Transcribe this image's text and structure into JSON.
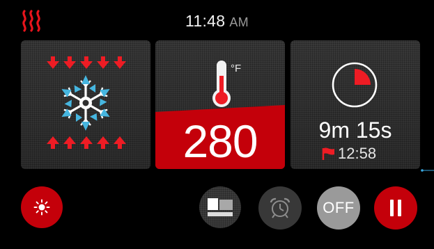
{
  "status_bar": {
    "heat_indicator_icon": "heat-waves-icon",
    "time": "11:48",
    "ampm": "AM"
  },
  "tiles": {
    "convection": {
      "icon": "convection-fan-icon"
    },
    "temperature": {
      "value": "280",
      "unit": "°F",
      "icon": "thermometer-icon"
    },
    "timer": {
      "icon": "timer-dial-icon",
      "remaining": "9m 15s",
      "end_time": "12:58",
      "end_icon": "flag-icon",
      "elapsed_fraction": 0.25
    }
  },
  "controls": {
    "light_icon": "sun-icon",
    "mode_icon": "oven-mode-icon",
    "alarm_icon": "alarm-clock-icon",
    "off_label": "OFF",
    "pause_icon": "pause-icon"
  },
  "colors": {
    "accent_red": "#c4000a",
    "bright_red": "#ff1e1e",
    "fan_blue": "#46b6e0",
    "tile_gray": "#333333",
    "off_gray": "#9a9a9a"
  }
}
